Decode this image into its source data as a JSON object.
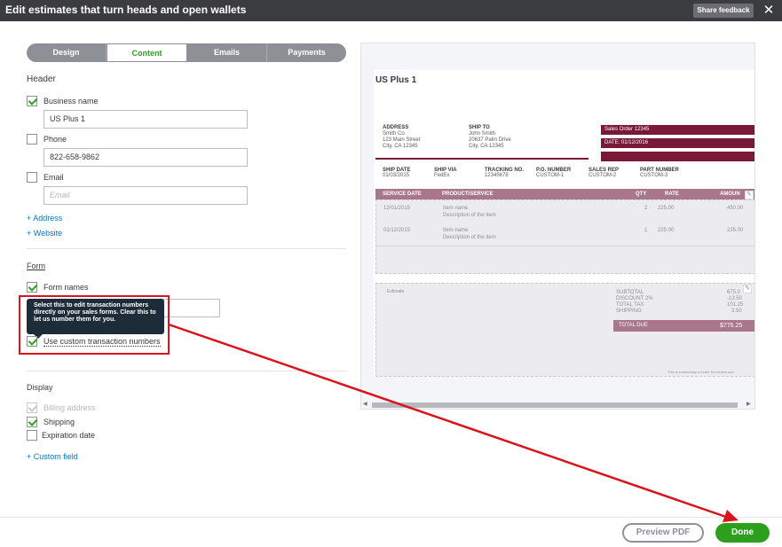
{
  "header": {
    "title": "Edit estimates that turn heads and open wallets",
    "share_label": "Share feedback",
    "close_glyph": "✕"
  },
  "tabs": [
    {
      "label": "Design",
      "active": false
    },
    {
      "label": "Content",
      "active": true
    },
    {
      "label": "Emails",
      "active": false
    },
    {
      "label": "Payments",
      "active": false
    }
  ],
  "header_section": {
    "heading": "Header",
    "business_name": {
      "label": "Business name",
      "checked": true,
      "value": "US Plus 1"
    },
    "phone": {
      "label": "Phone",
      "checked": false,
      "value": "822-658-9862"
    },
    "email": {
      "label": "Email",
      "checked": false,
      "placeholder": "Email"
    },
    "add_address": "+ Address",
    "add_website": "+ Website"
  },
  "form_section": {
    "heading": "Form",
    "form_names": {
      "label": "Form names",
      "checked": true
    },
    "custom_numbers": {
      "label": "Use custom transaction numbers",
      "checked": true
    },
    "tooltip": "Select this to edit transaction numbers directly on your sales forms. Clear this to let us number them for you."
  },
  "display_section": {
    "heading": "Display",
    "billing_address": {
      "label": "Billing address",
      "checked": true,
      "disabled": true
    },
    "shipping": {
      "label": "Shipping",
      "checked": true
    },
    "expiration_date": {
      "label": "Expiration date",
      "checked": false
    },
    "add_custom_field": "+ Custom field"
  },
  "preview": {
    "company": "US Plus 1",
    "address": {
      "heading": "ADDRESS",
      "lines": [
        "Smith Co.",
        "123 Main Street",
        "City, CA 12345"
      ]
    },
    "ship_to": {
      "heading": "SHIP TO",
      "lines": [
        "John Smith",
        "20637 Palm Drive",
        "City, CA 12345"
      ]
    },
    "sales_order": "Sales Order 12345",
    "date": "DATE: 01/12/2016",
    "meta": [
      {
        "heading": "SHIP DATE",
        "value": "01/03/2015"
      },
      {
        "heading": "SHIP VIA",
        "value": "FedEx"
      },
      {
        "heading": "TRACKING NO.",
        "value": "12345678"
      },
      {
        "heading": "P.O. NUMBER",
        "value": "CUSTOM-1"
      },
      {
        "heading": "SALES REP",
        "value": "CUSTOM-2"
      },
      {
        "heading": "PART NUMBER",
        "value": "CUSTOM-3"
      }
    ],
    "columns": [
      "SERVICE DATE",
      "PRODUCT/SERVICE",
      "QTY",
      "RATE",
      "AMOUN"
    ],
    "rows": [
      {
        "date": "12/01/2015",
        "name": "Item name",
        "desc": "Description of the item",
        "qty": "2",
        "rate": "225.00",
        "amount": "450.00"
      },
      {
        "date": "01/12/2015",
        "name": "Item name",
        "desc": "Description of the item",
        "qty": "1",
        "rate": "225.00",
        "amount": "225.00"
      }
    ],
    "estimate_note": "Estimate",
    "totals": [
      {
        "label": "SUBTOTAL",
        "value": "675.0"
      },
      {
        "label": "DISCOUNT 2%",
        "value": "-13.50"
      },
      {
        "label": "TOTAL TAX",
        "value": "101.25"
      },
      {
        "label": "SHIPPING",
        "value": "3.50"
      }
    ],
    "total_due": {
      "label": "TOTAL DUE",
      "value": "$776.25"
    },
    "footer_note": "This is customarily a footer for invoice usa"
  },
  "footer": {
    "preview_pdf": "Preview PDF",
    "done": "Done"
  },
  "colors": {
    "accent_green": "#2ca01c",
    "maroon": "#7a1838",
    "annotation_red": "#d8151e"
  }
}
